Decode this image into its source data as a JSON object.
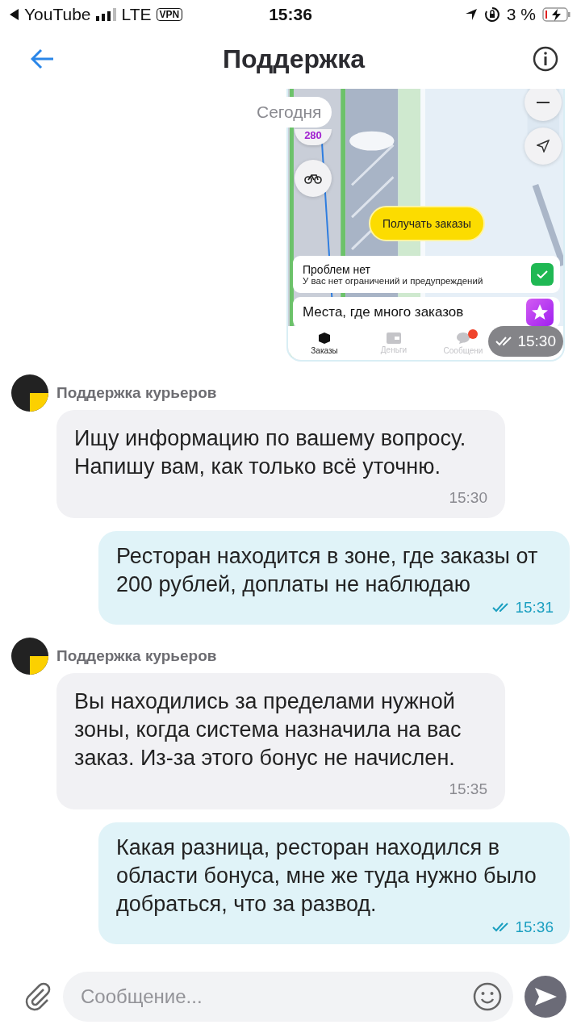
{
  "status_bar": {
    "back_app": "YouTube",
    "network": "LTE",
    "vpn": "VPN",
    "time": "15:36",
    "battery": "3 %",
    "charging": true
  },
  "header": {
    "title": "Поддержка"
  },
  "date_label": "Сегодня",
  "messages": [
    {
      "time": "15:30",
      "read": true,
      "screenshot": {
        "badge": "280",
        "action_button": "Получать заказы",
        "status_card": {
          "title": "Проблем нет",
          "subtitle": "У вас нет ограничений и предупреждений",
          "ok": true
        },
        "promo_card": "Места, где много заказов",
        "tabs": [
          {
            "label": "Заказы",
            "selected": true
          },
          {
            "label": "Деньги",
            "selected": false
          },
          {
            "label": "Сообщени",
            "selected": false,
            "unread": true
          }
        ]
      }
    },
    {
      "kind": "incoming",
      "sender": "Поддержка курьеров",
      "text": "Ищу информацию по вашему вопросу. Напишу вам, как только всё уточню.",
      "time": "15:30"
    },
    {
      "kind": "outgoing",
      "text": "Ресторан находится в зоне, где заказы от 200 рублей, доплаты не наблюдаю",
      "time": "15:31",
      "read": true
    },
    {
      "kind": "incoming",
      "sender": "Поддержка курьеров",
      "text": "Вы находились за пределами нужной зоны, когда система назначила на вас заказ. Из-за этого бонус не начислен.",
      "time": "15:35"
    },
    {
      "kind": "outgoing",
      "text": "Какая разница, ресторан находился в области бонуса, мне же туда нужно было добраться, что за развод.",
      "time": "15:36",
      "read": true
    }
  ],
  "composer": {
    "placeholder": "Сообщение..."
  }
}
